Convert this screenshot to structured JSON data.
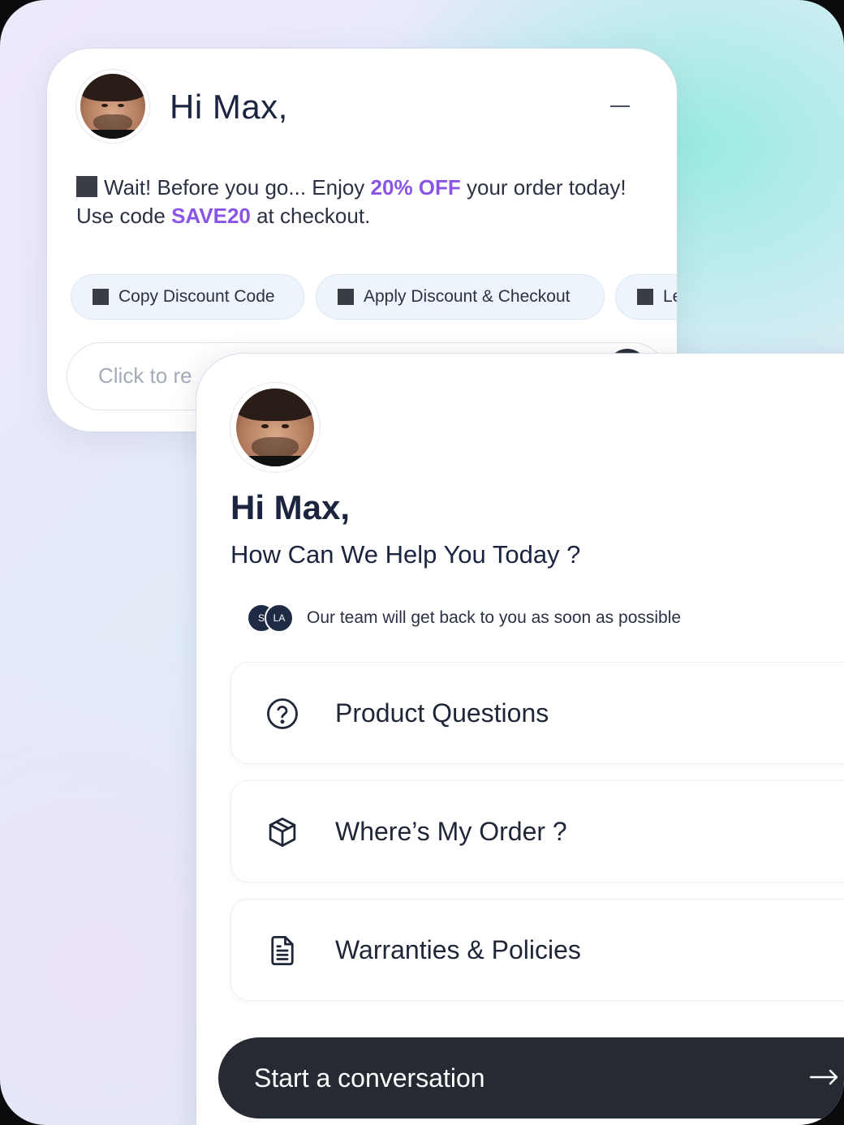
{
  "popup": {
    "greeting": "Hi Max,",
    "message_pre": "Wait! Before you go... Enjoy ",
    "message_discount": "20% OFF",
    "message_mid": " your order today! Use code ",
    "message_code": "SAVE20",
    "message_post": " at checkout.",
    "chips": [
      {
        "label": "Copy Discount Code"
      },
      {
        "label": "Apply Discount & Checkout"
      },
      {
        "label": "Le"
      }
    ],
    "reply_placeholder": "Click to re"
  },
  "widget": {
    "greeting": "Hi Max,",
    "subtitle": "How Can We Help You Today ?",
    "team_avatars": [
      "S",
      "LA"
    ],
    "team_text": "Our team will get back to you as soon as possible",
    "options": [
      {
        "label": "Product Questions",
        "icon": "question-circle-icon"
      },
      {
        "label": "Where’s My Order ?",
        "icon": "package-icon"
      },
      {
        "label": "Warranties & Policies",
        "icon": "document-icon"
      }
    ],
    "cta_label": "Start a conversation",
    "cta_icon": "arrow-right-icon"
  },
  "colors": {
    "accent": "#8a55e6",
    "primary_text": "#1b2540",
    "cta_bg": "#262a33"
  }
}
